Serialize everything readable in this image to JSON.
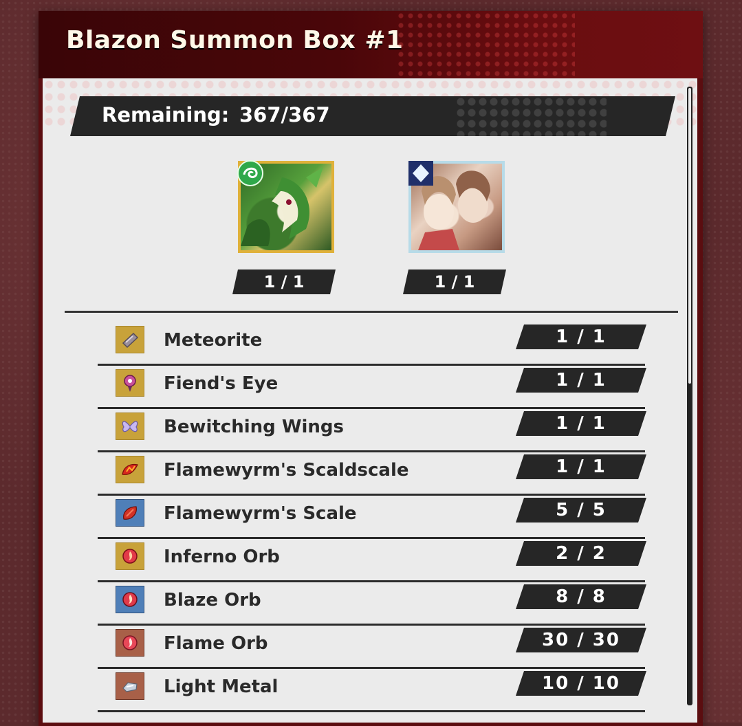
{
  "header": {
    "title": "Blazon Summon Box #1"
  },
  "remaining": {
    "label": "Remaining:",
    "value": "367/367"
  },
  "featured": [
    {
      "count": "1 / 1",
      "icon": "green-wind-element-icon",
      "portrait": "green-dragon-portrait"
    },
    {
      "count": "1 / 1",
      "icon": "white-diamond-badge-icon",
      "portrait": "two-girls-portrait"
    }
  ],
  "items": [
    {
      "name": "Meteorite",
      "count": "1  /  1",
      "icon": "meteorite-icon",
      "frame": "gold"
    },
    {
      "name": "Fiend's Eye",
      "count": "1  /  1",
      "icon": "fiends-eye-icon",
      "frame": "gold"
    },
    {
      "name": "Bewitching Wings",
      "count": "1  /  1",
      "icon": "bewitching-wings-icon",
      "frame": "gold"
    },
    {
      "name": "Flamewyrm's Scaldscale",
      "count": "1  /  1",
      "icon": "scaldscale-icon",
      "frame": "gold"
    },
    {
      "name": "Flamewyrm's Scale",
      "count": "5  /  5",
      "icon": "flamewyrm-scale-icon",
      "frame": "blue"
    },
    {
      "name": "Inferno Orb",
      "count": "2  /  2",
      "icon": "inferno-orb-icon",
      "frame": "gold"
    },
    {
      "name": "Blaze Orb",
      "count": "8  /  8",
      "icon": "blaze-orb-icon",
      "frame": "blue"
    },
    {
      "name": "Flame Orb",
      "count": "30  /  30",
      "icon": "flame-orb-icon",
      "frame": "brown"
    },
    {
      "name": "Light Metal",
      "count": "10  /  10",
      "icon": "light-metal-icon",
      "frame": "brown"
    }
  ],
  "colors": {
    "header_red": "#5b0d10",
    "panel": "#ebebeb",
    "bar": "#262626"
  }
}
